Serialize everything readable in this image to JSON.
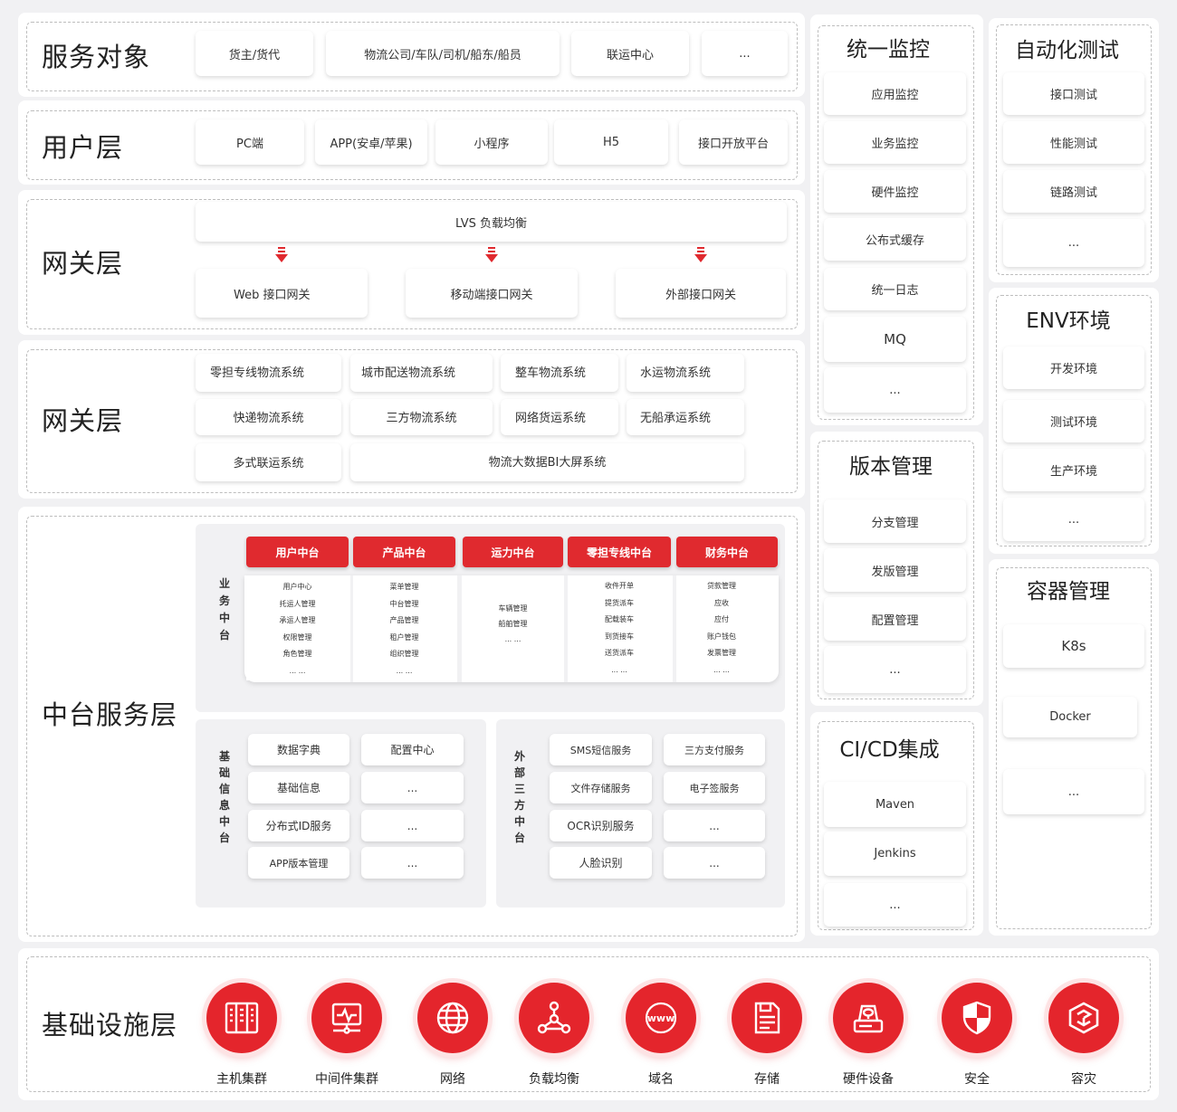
{
  "service_targets": {
    "title": "服务对象",
    "items": [
      "货主/货代",
      "物流公司/车队/司机/船东/船员",
      "联运中心",
      "..."
    ]
  },
  "user_layer": {
    "title": "用户层",
    "items": [
      "PC端",
      "APP(安卓/苹果)",
      "小程序",
      "H5",
      "接口开放平台"
    ]
  },
  "gateway_layer": {
    "title": "网关层",
    "lb": "LVS 负载均衡",
    "gateways": [
      "Web 接口网关",
      "移动端接口网关",
      "外部接口网关"
    ]
  },
  "systems_layer": {
    "title": "网关层",
    "row1": [
      "零担专线物流系统",
      "城市配送物流系统",
      "整车物流系统",
      "水运物流系统"
    ],
    "row2": [
      "快递物流系统",
      "三方物流系统",
      "网络货运系统",
      "无船承运系统"
    ],
    "row3": [
      "多式联运系统",
      "物流大数据BI大屏系统"
    ]
  },
  "middle_layer": {
    "title": "中台服务层",
    "biz_label": "业务中台",
    "biz_tabs": [
      {
        "name": "用户中台",
        "items": [
          "用户中心",
          "托运人管理",
          "承运人管理",
          "权限管理",
          "角色管理",
          "... ..."
        ]
      },
      {
        "name": "产品中台",
        "items": [
          "菜单管理",
          "中台管理",
          "产品管理",
          "租户管理",
          "组织管理",
          "... ..."
        ]
      },
      {
        "name": "运力中台",
        "items": [
          "车辆管理",
          "船舶管理",
          "... ..."
        ]
      },
      {
        "name": "零担专线中台",
        "items": [
          "收件开单",
          "提货派车",
          "配载装车",
          "到货接车",
          "送货派车",
          "... ..."
        ]
      },
      {
        "name": "财务中台",
        "items": [
          "贷款管理",
          "应收",
          "应付",
          "账户钱包",
          "发票管理",
          "... ..."
        ]
      }
    ],
    "basic_label": "基础信息中台",
    "basic_col1": [
      "数据字典",
      "基础信息",
      "分布式ID服务",
      "APP版本管理"
    ],
    "basic_col2": [
      "配置中心",
      "...",
      "...",
      "..."
    ],
    "external_label": "外部三方中台",
    "external_col1": [
      "SMS短信服务",
      "文件存储服务",
      "OCR识别服务",
      "人脸识别"
    ],
    "external_col2": [
      "三方支付服务",
      "电子签服务",
      "...",
      "..."
    ]
  },
  "monitoring": {
    "title": "统一监控",
    "items": [
      "应用监控",
      "业务监控",
      "硬件监控",
      "公布式缓存",
      "统一日志",
      "MQ",
      "..."
    ]
  },
  "version_mgmt": {
    "title": "版本管理",
    "items": [
      "分支管理",
      "发版管理",
      "配置管理",
      "..."
    ]
  },
  "cicd": {
    "title": "CI/CD集成",
    "items": [
      "Maven",
      "Jenkins",
      "..."
    ]
  },
  "auto_test": {
    "title": "自动化测试",
    "items": [
      "接口测试",
      "性能测试",
      "链路测试",
      "..."
    ]
  },
  "env": {
    "title": "ENV环境",
    "items": [
      "开发环境",
      "测试环境",
      "生产环境",
      "..."
    ]
  },
  "container": {
    "title": "容器管理",
    "items": [
      "K8s",
      "Docker",
      "..."
    ]
  },
  "infra_layer": {
    "title": "基础设施层",
    "items": [
      {
        "label": "主机集群",
        "icon": "server-cluster-icon"
      },
      {
        "label": "中间件集群",
        "icon": "middleware-icon"
      },
      {
        "label": "网络",
        "icon": "globe-icon"
      },
      {
        "label": "负载均衡",
        "icon": "load-balance-icon"
      },
      {
        "label": "域名",
        "icon": "www-icon"
      },
      {
        "label": "存储",
        "icon": "storage-icon"
      },
      {
        "label": "硬件设备",
        "icon": "hardware-icon"
      },
      {
        "label": "安全",
        "icon": "shield-icon"
      },
      {
        "label": "容灾",
        "icon": "disaster-recovery-icon"
      }
    ],
    "accent_color": "#e4252c"
  }
}
